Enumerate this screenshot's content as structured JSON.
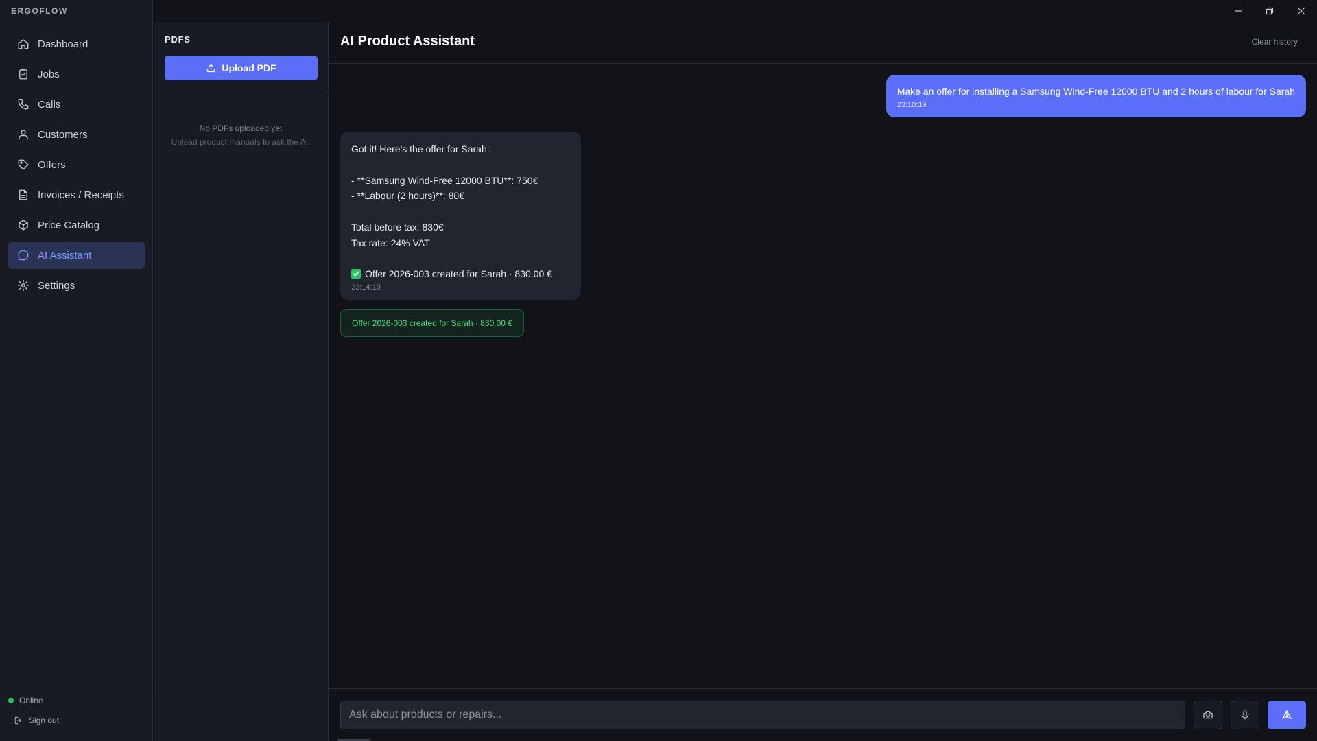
{
  "app": {
    "brand": "ERGOFLOW"
  },
  "sidebar": {
    "items": [
      {
        "label": "Dashboard",
        "icon": "home-icon"
      },
      {
        "label": "Jobs",
        "icon": "clipboard-icon"
      },
      {
        "label": "Calls",
        "icon": "phone-icon"
      },
      {
        "label": "Customers",
        "icon": "user-icon"
      },
      {
        "label": "Offers",
        "icon": "tag-icon"
      },
      {
        "label": "Invoices / Receipts",
        "icon": "document-icon"
      },
      {
        "label": "Price Catalog",
        "icon": "box-icon"
      },
      {
        "label": "AI Assistant",
        "icon": "chat-icon",
        "active": true
      },
      {
        "label": "Settings",
        "icon": "gear-icon"
      }
    ],
    "status": "Online",
    "sign_out": "Sign out"
  },
  "pdf_panel": {
    "title": "PDFS",
    "upload_label": "Upload PDF",
    "empty_title": "No PDFs uploaded yet",
    "empty_subtitle": "Upload product manuals to ask the AI."
  },
  "chat": {
    "title": "AI Product Assistant",
    "clear_label": "Clear history",
    "user_message": {
      "text": "Make an offer for installing a Samsung Wind-Free 12000 BTU and 2 hours of labour for Sarah",
      "time": "23:10:19"
    },
    "ai_message": {
      "line1": "Got it! Here's the offer for Sarah:",
      "line2": "- **Samsung Wind-Free 12000 BTU**: 750€",
      "line3": "- **Labour (2 hours)**: 80€",
      "line4": "Total before tax: 830€",
      "line5": "Tax rate: 24% VAT",
      "line6": "Offer 2026-003 created for Sarah · 830.00 €",
      "time": "23:14:19"
    },
    "offer_chip": "Offer 2026-003 created for Sarah · 830.00 €"
  },
  "composer": {
    "placeholder": "Ask about products or repairs..."
  },
  "colors": {
    "accent": "#5b6ef7",
    "success": "#22c55e",
    "background": "#111318"
  }
}
